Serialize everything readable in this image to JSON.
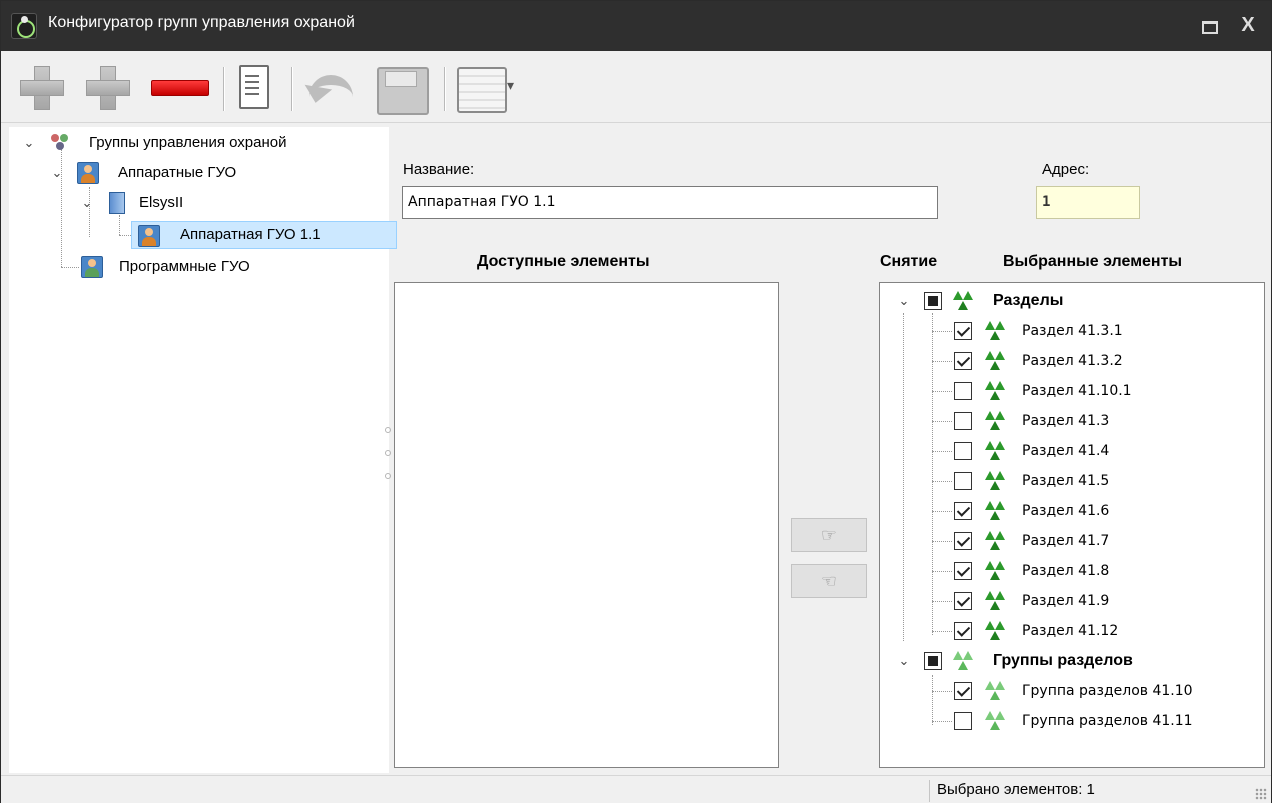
{
  "window": {
    "title": "Конфигуратор групп управления охраной",
    "close_label": "X"
  },
  "toolbar": {
    "buttons": [
      {
        "name": "add-icon"
      },
      {
        "name": "add-child-icon"
      },
      {
        "name": "delete-icon"
      },
      {
        "name": "document-icon"
      },
      {
        "name": "undo-icon"
      },
      {
        "name": "save-icon"
      },
      {
        "name": "view-options-icon"
      }
    ]
  },
  "left_tree": {
    "root": "Группы управления охраной",
    "hardware": "Аппаратные ГУО",
    "device": "ElsysII",
    "selected_item": "Аппаратная ГУО 1.1",
    "software": "Программные ГУО"
  },
  "form": {
    "name_label": "Название:",
    "name_value": "Аппаратная ГУО 1.1",
    "address_label": "Адрес:",
    "address_value": "1"
  },
  "available": {
    "header": "Доступные элементы"
  },
  "move_buttons": {
    "to_right": "☞",
    "to_left": "☜"
  },
  "selected": {
    "disarm_header": "Снятие",
    "header": "Выбранные элементы",
    "sections_group": "Разделы",
    "sections": [
      {
        "label": "Раздел 41.3.1",
        "checked": true
      },
      {
        "label": "Раздел 41.3.2",
        "checked": true
      },
      {
        "label": "Раздел 41.10.1",
        "checked": false
      },
      {
        "label": "Раздел 41.3",
        "checked": false
      },
      {
        "label": "Раздел 41.4",
        "checked": false
      },
      {
        "label": "Раздел 41.5",
        "checked": false
      },
      {
        "label": "Раздел 41.6",
        "checked": true
      },
      {
        "label": "Раздел 41.7",
        "checked": true
      },
      {
        "label": "Раздел 41.8",
        "checked": true
      },
      {
        "label": "Раздел 41.9",
        "checked": true
      },
      {
        "label": "Раздел 41.12",
        "checked": true
      }
    ],
    "section_groups_group": "Группы разделов",
    "section_groups": [
      {
        "label": "Группа разделов 41.10",
        "checked": true
      },
      {
        "label": "Группа разделов 41.11",
        "checked": false
      }
    ]
  },
  "status": {
    "text": "Выбрано элементов: 1"
  }
}
